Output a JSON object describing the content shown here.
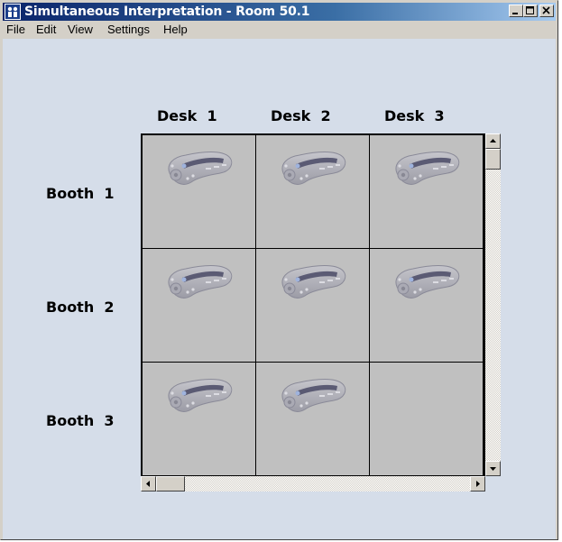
{
  "window": {
    "title": "Simultaneous Interpretation - Room 50.1"
  },
  "menu": [
    "File",
    "Edit",
    "View",
    "Settings",
    "Help"
  ],
  "grid": {
    "columns": [
      "Desk  1",
      "Desk  2",
      "Desk  3"
    ],
    "rows": [
      "Booth  1",
      "Booth  2",
      "Booth  3"
    ],
    "cells": [
      [
        true,
        true,
        true
      ],
      [
        true,
        true,
        true
      ],
      [
        true,
        true,
        false
      ]
    ],
    "cell_icon": "interpreter-desk-icon"
  },
  "icons": {
    "app": "interpreter-app-icon",
    "minimize": "minimize-icon",
    "maximize": "maximize-icon",
    "close": "close-icon",
    "scroll_up": "arrow-up-icon",
    "scroll_down": "arrow-down-icon",
    "scroll_left": "arrow-left-icon",
    "scroll_right": "arrow-right-icon"
  },
  "colors": {
    "client_bg": "#d5dde9",
    "cell_bg": "#c0c0c0",
    "title_start": "#0a246a",
    "title_end": "#a6caf0"
  }
}
